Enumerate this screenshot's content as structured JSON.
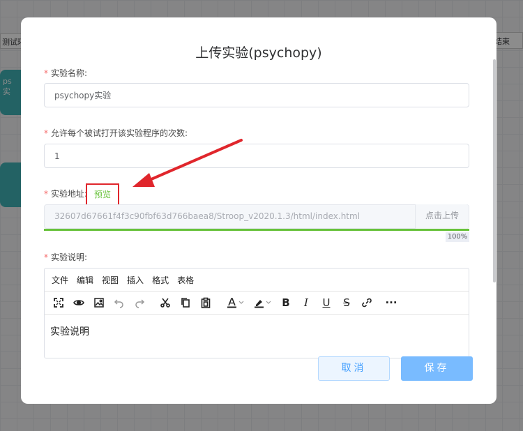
{
  "background": {
    "left_label": "测试环境",
    "card1_text": "ps",
    "card1_sub": "实",
    "right_button": "结束"
  },
  "dialog": {
    "title": "上传实验(psychopy)",
    "fields": {
      "name": {
        "label": "实验名称:",
        "value": "psychopy实验"
      },
      "times": {
        "label": "允许每个被试打开该实验程序的次数:",
        "value": "1"
      },
      "address": {
        "label": "实验地址:",
        "preview_link": "预览",
        "url": "32607d67661f4f3c90fbf63d766baea8/Stroop_v2020.1.3/html/index.html",
        "upload_button": "点击上传",
        "progress": 100,
        "progress_text": "100%"
      },
      "description": {
        "label": "实验说明:",
        "menu": [
          "文件",
          "编辑",
          "视图",
          "插入",
          "格式",
          "表格"
        ],
        "toolbar_icons": [
          "fullscreen-icon",
          "preview-eye-icon",
          "image-icon",
          "undo-icon",
          "redo-icon",
          "cut-icon",
          "copy-icon",
          "paste-icon",
          "text-color-icon",
          "highlight-icon",
          "bold-icon",
          "italic-icon",
          "underline-icon",
          "strikethrough-icon",
          "link-icon",
          "more-icon"
        ],
        "content": "实验说明"
      }
    },
    "buttons": {
      "cancel": "取消",
      "save": "保存"
    }
  },
  "colors": {
    "required": "#f56c6c",
    "success": "#67c23a",
    "primary": "#409eff",
    "annotation": "#e0262c"
  }
}
